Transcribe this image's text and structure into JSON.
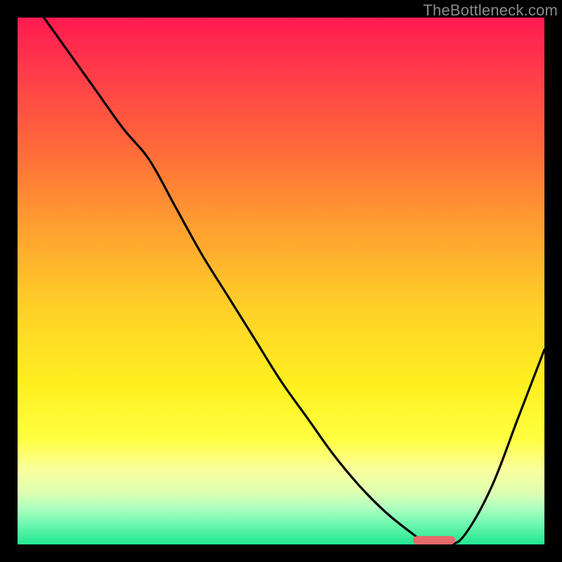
{
  "watermark": "TheBottleneck.com",
  "chart_data": {
    "type": "line",
    "title": "",
    "xlabel": "",
    "ylabel": "",
    "xlim": [
      0,
      100
    ],
    "ylim": [
      0,
      100
    ],
    "grid": false,
    "legend": false,
    "background_gradient": {
      "top": "#ff1a50",
      "mid": "#fff020",
      "bottom": "#20e890"
    },
    "series": [
      {
        "name": "bottleneck-curve",
        "color": "#000000",
        "x": [
          5,
          10,
          15,
          20,
          25,
          30,
          35,
          40,
          45,
          50,
          55,
          60,
          65,
          70,
          75,
          78,
          82,
          85,
          90,
          95,
          100
        ],
        "values": [
          100,
          93,
          86,
          79,
          73,
          64,
          55,
          47,
          39,
          31,
          24,
          17,
          11,
          6,
          2,
          0,
          0,
          2,
          11,
          24,
          37
        ]
      }
    ],
    "marker": {
      "name": "optimal-range",
      "color": "#e66a6a",
      "x_start": 75,
      "x_end": 83,
      "y": 0
    }
  }
}
